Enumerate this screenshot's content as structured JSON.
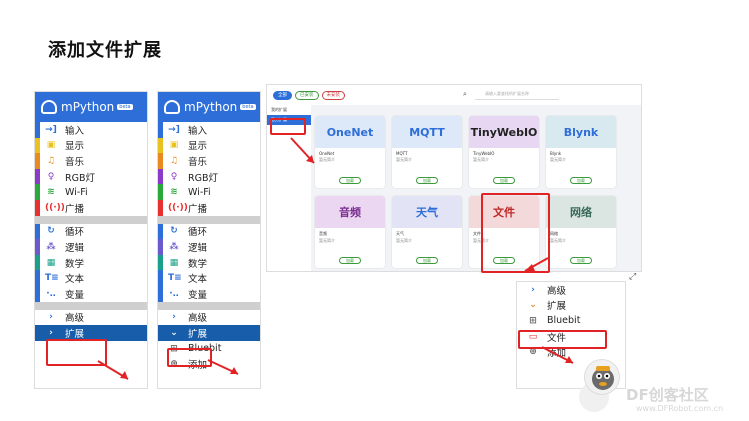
{
  "slide": {
    "title": "添加文件扩展"
  },
  "colors": {
    "brand": "#2d6ed8",
    "dark": "#175daa",
    "red": "#e12326"
  },
  "p1": {
    "app_name": "mPython",
    "beta": "beta",
    "items": [
      {
        "icon": "→]",
        "label": "输入",
        "color": "#2d6ed8"
      },
      {
        "icon": "▣",
        "label": "显示",
        "color": "#e8c320"
      },
      {
        "icon": "♫",
        "label": "音乐",
        "color": "#e88a20"
      },
      {
        "icon": "♀",
        "label": "RGB灯",
        "color": "#8a3cc8"
      },
      {
        "icon": "≋",
        "label": "Wi-Fi",
        "color": "#2aa83a"
      },
      {
        "icon": "((·))",
        "label": "广播",
        "color": "#e83030"
      },
      {
        "icon": "↻",
        "label": "循环",
        "color": "#2d6ed8"
      },
      {
        "icon": "⁂",
        "label": "逻辑",
        "color": "#6a5acd"
      },
      {
        "icon": "▦",
        "label": "数学",
        "color": "#1aa08a"
      },
      {
        "icon": "T≡",
        "label": "文本",
        "color": "#2d6ed8"
      },
      {
        "icon": "·‥",
        "label": "变量",
        "color": "#2d6ed8"
      },
      {
        "icon": "›",
        "label": "高级",
        "color": "#2d6ed8"
      },
      {
        "icon": "›",
        "label": "扩展",
        "color": "#ffffff"
      }
    ]
  },
  "p2": {
    "app_name": "mPython",
    "beta": "beta",
    "items": [
      {
        "icon": "→]",
        "label": "输入",
        "color": "#2d6ed8"
      },
      {
        "icon": "▣",
        "label": "显示",
        "color": "#e8c320"
      },
      {
        "icon": "♫",
        "label": "音乐",
        "color": "#e88a20"
      },
      {
        "icon": "♀",
        "label": "RGB灯",
        "color": "#8a3cc8"
      },
      {
        "icon": "≋",
        "label": "Wi-Fi",
        "color": "#2aa83a"
      },
      {
        "icon": "((·))",
        "label": "广播",
        "color": "#e83030"
      },
      {
        "icon": "↻",
        "label": "循环",
        "color": "#2d6ed8"
      },
      {
        "icon": "⁂",
        "label": "逻辑",
        "color": "#6a5acd"
      },
      {
        "icon": "▦",
        "label": "数学",
        "color": "#1aa08a"
      },
      {
        "icon": "T≡",
        "label": "文本",
        "color": "#2d6ed8"
      },
      {
        "icon": "·‥",
        "label": "变量",
        "color": "#2d6ed8"
      },
      {
        "icon": "›",
        "label": "高级",
        "color": "#2d6ed8"
      },
      {
        "icon": "⌄",
        "label": "扩展",
        "color": "#ffffff"
      },
      {
        "icon": "⊞",
        "label": "Bluebit",
        "color": "#666666"
      },
      {
        "icon": "⊕",
        "label": "添加",
        "color": "#666666"
      }
    ]
  },
  "p3": {
    "chips": [
      "全部",
      "已安装",
      "未安装"
    ],
    "search_placeholder": "请输入要查找的扩展名称",
    "side": [
      "我的扩展",
      "官方扩展"
    ],
    "cards": [
      {
        "name": "OneNet",
        "sub": "OneNet",
        "desc": "暂无简介",
        "btn": "加载",
        "bg": "#dde8f8",
        "fg": "#2d6ed8"
      },
      {
        "name": "MQTT",
        "sub": "MQTT",
        "desc": "暂无简介",
        "btn": "加载",
        "bg": "#dde8f8",
        "fg": "#2d6ed8"
      },
      {
        "name": "TinyWebIO",
        "sub": "TinyWebIO",
        "desc": "暂无简介",
        "btn": "加载",
        "bg": "#e8d7f2",
        "fg": "#222222"
      },
      {
        "name": "Blynk",
        "sub": "Blynk",
        "desc": "暂无简介",
        "btn": "加载",
        "bg": "#d9e9f0",
        "fg": "#2d6ed8"
      },
      {
        "name": "音频",
        "sub": "音频",
        "desc": "暂无简介",
        "btn": "加载",
        "bg": "#ecd7f3",
        "fg": "#7a2f8f"
      },
      {
        "name": "天气",
        "sub": "天气",
        "desc": "暂无简介",
        "btn": "加载",
        "bg": "#e2e3f5",
        "fg": "#2d6ed8"
      },
      {
        "name": "文件",
        "sub": "文件",
        "desc": "暂无简介",
        "btn": "加载",
        "bg": "#f4d9da",
        "fg": "#c02828"
      },
      {
        "name": "网络",
        "sub": "网络",
        "desc": "暂无简介",
        "btn": "加载",
        "bg": "#dbe5e2",
        "fg": "#3a6a5a"
      }
    ]
  },
  "p4": {
    "items": [
      {
        "icon": "›",
        "label": "高级",
        "color": "#2d6ed8"
      },
      {
        "icon": "⌄",
        "label": "扩展",
        "color": "#e88a20"
      },
      {
        "icon": "⊞",
        "label": "Bluebit",
        "color": "#666666"
      },
      {
        "icon": "▭",
        "label": "文件",
        "color": "#e12326"
      },
      {
        "icon": "⊕",
        "label": "添加",
        "color": "#666666"
      }
    ]
  },
  "watermark": {
    "brand": "DF创客社区",
    "url": "www.DFRobot.com.cn"
  }
}
